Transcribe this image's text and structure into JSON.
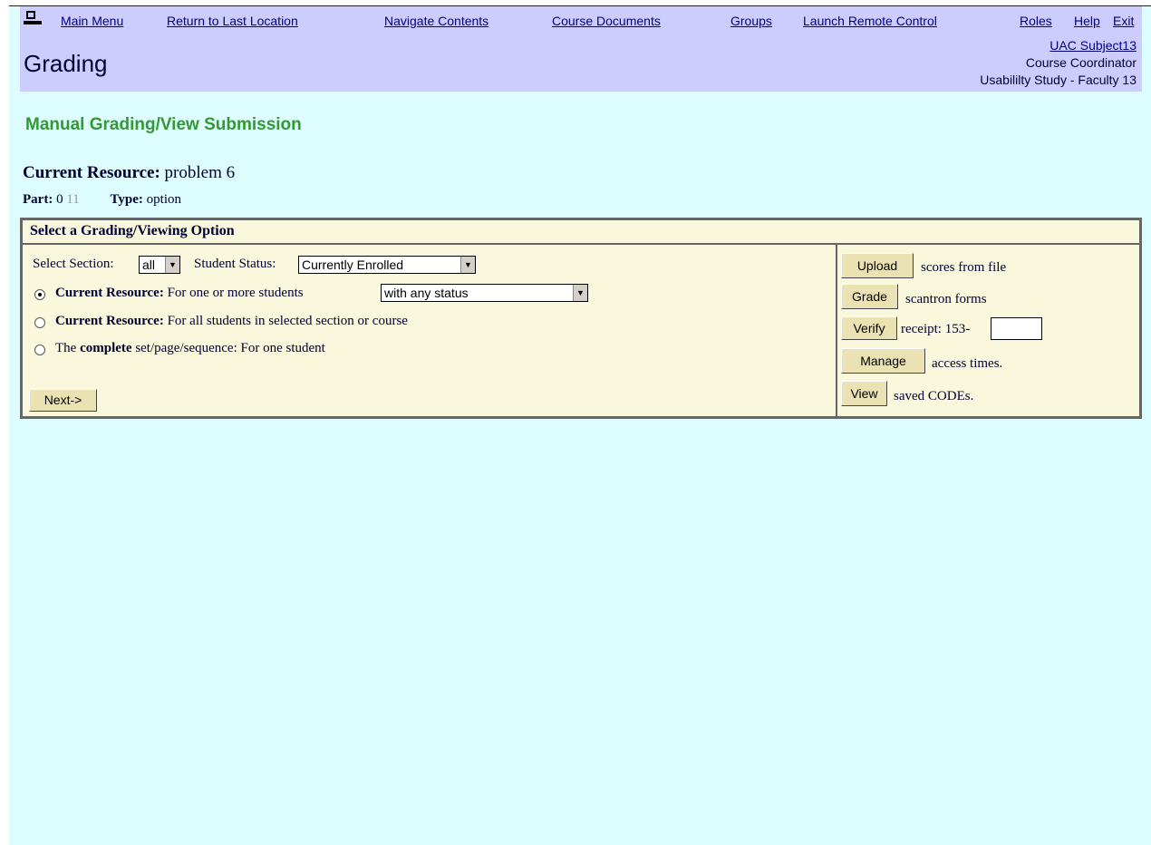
{
  "nav": {
    "main_menu": "Main Menu",
    "return_last": "Return to Last Location",
    "navigate_contents": "Navigate Contents",
    "course_documents": "Course Documents",
    "groups": "Groups",
    "launch_remote": "Launch Remote Control",
    "roles": "Roles",
    "help": "Help",
    "exit": "Exit"
  },
  "header": {
    "title": "Grading",
    "user_name": "UAC Subject13",
    "role": "Course Coordinator",
    "course": "Usabililty Study - Faculty 13"
  },
  "main": {
    "heading": "Manual Grading/View Submission",
    "resource_label": "Current Resource:",
    "resource_value": "problem 6",
    "part_label": "Part:",
    "part_value": "0",
    "part_id": "11",
    "type_label": "Type:",
    "type_value": "option"
  },
  "options": {
    "title": "Select a Grading/Viewing Option",
    "section_label": "Select Section:",
    "section_value": "all",
    "status_label": "Student Status:",
    "status_value": "Currently Enrolled",
    "opt1_bold": "Current Resource:",
    "opt1_text": "For one or more students",
    "opt1_select": "with any status",
    "opt2_bold": "Current Resource:",
    "opt2_text": "For all students in selected section or course",
    "opt3_pre": "The",
    "opt3_bold": "complete",
    "opt3_text": "set/page/sequence: For one student",
    "next_label": "Next->"
  },
  "actions": {
    "upload_label": "Upload",
    "upload_text": "scores from file",
    "grade_label": "Grade",
    "grade_text": "scantron forms",
    "verify_label": "Verify",
    "verify_text": "receipt: 153-",
    "manage_label": "Manage",
    "manage_text": "access times.",
    "view_label": "View",
    "view_text": "saved CODEs."
  }
}
